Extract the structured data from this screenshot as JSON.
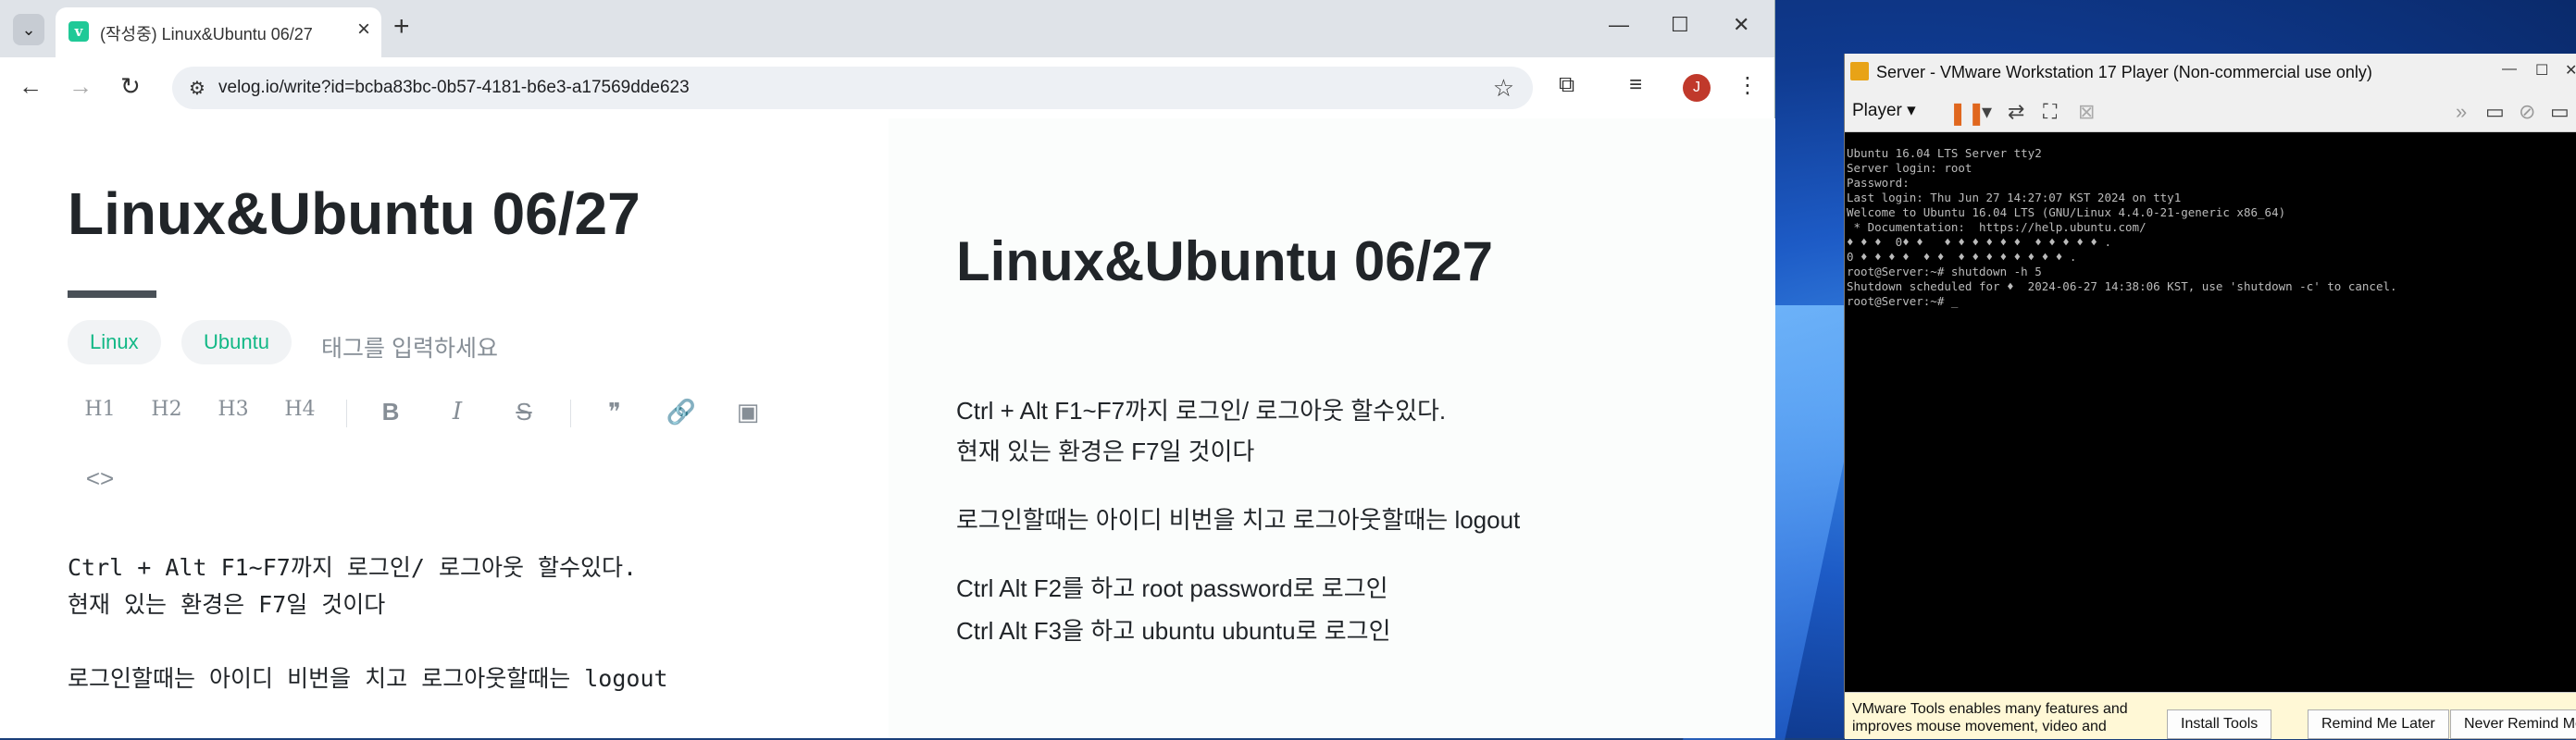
{
  "browser": {
    "tab_title": "(작성중) Linux&Ubuntu 06/27",
    "favicon_letter": "v",
    "url": "velog.io/write?id=bcba83bc-0b57-4181-b6e3-a17569dde623",
    "avatar_letter": "J"
  },
  "editor": {
    "title": "Linux&Ubuntu 06/27",
    "tags": [
      "Linux",
      "Ubuntu"
    ],
    "tag_placeholder": "태그를 입력하세요",
    "toolbar": {
      "h1": "H1",
      "h2": "H2",
      "h3": "H3",
      "h4": "H4",
      "bold": "B",
      "italic": "I",
      "strike": "S",
      "quote": "❞",
      "link": "🔗",
      "image": "▣",
      "code": "<>"
    },
    "lines": [
      "Ctrl + Alt F1~F7까지 로그인/ 로그아웃 할수있다.",
      "현재 있는 환경은 F7일 것이다",
      "로그인할때는 아이디 비번을 치고 로그아웃할때는 logout"
    ]
  },
  "preview": {
    "title": "Linux&Ubuntu 06/27",
    "lines": [
      "Ctrl + Alt F1~F7까지 로그인/ 로그아웃 할수있다.",
      "현재 있는 환경은 F7일 것이다",
      "로그인할때는 아이디 비번을 치고 로그아웃할때는 logout",
      "Ctrl Alt F2를 하고 root password로 로그인",
      "Ctrl Alt F3을 하고 ubuntu ubuntu로 로그인"
    ]
  },
  "vmware": {
    "title": "Server - VMware Workstation 17 Player (Non-commercial use only)",
    "menu_label": "Player",
    "terminal": [
      "Ubuntu 16.04 LTS Server tty2",
      "",
      "Server login: root",
      "Password:",
      "Last login: Thu Jun 27 14:27:07 KST 2024 on tty1",
      "Welcome to Ubuntu 16.04 LTS (GNU/Linux 4.4.0-21-generic x86_64)",
      "",
      " * Documentation:  https://help.ubuntu.com/",
      "",
      "♦ ♦ ♦  0♦ ♦   ♦ ♦ ♦ ♦ ♦ ♦  ♦ ♦ ♦ ♦ ♦ .",
      "0 ♦ ♦ ♦ ♦  ♦ ♦  ♦ ♦ ♦ ♦ ♦ ♦ ♦ ♦ .",
      "",
      "root@Server:~# shutdown -h 5",
      "Shutdown scheduled for ♦  2024-06-27 14:38:06 KST, use 'shutdown -c' to cancel.",
      "root@Server:~# _"
    ],
    "notice": "VMware Tools enables many features and improves mouse movement, video and",
    "buttons": {
      "install": "Install Tools",
      "remind_later": "Remind Me Later",
      "never": "Never Remind Me"
    }
  }
}
